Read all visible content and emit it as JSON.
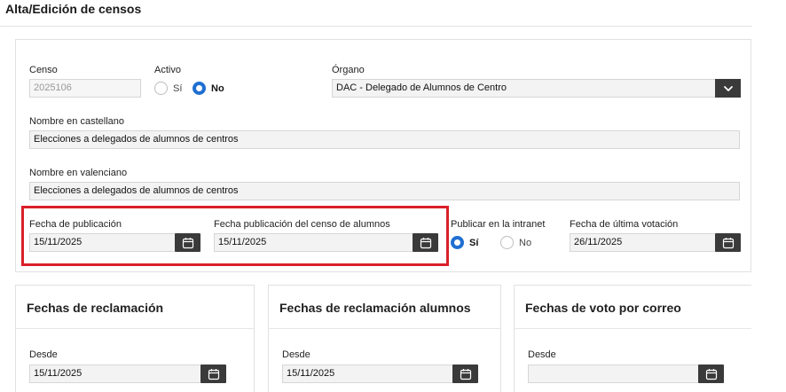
{
  "page": {
    "title": "Alta/Edición de censos"
  },
  "form": {
    "censo": {
      "label": "Censo",
      "value": "2025106"
    },
    "activo": {
      "label": "Activo",
      "options": [
        "Sí",
        "No"
      ],
      "selected": "No"
    },
    "organo": {
      "label": "Órgano",
      "value": "DAC - Delegado de Alumnos de Centro"
    },
    "nombre_castellano": {
      "label": "Nombre en castellano",
      "value": "Elecciones a delegados de alumnos de centros"
    },
    "nombre_valenciano": {
      "label": "Nombre en valenciano",
      "value": "Elecciones a delegados de alumnos de centros"
    },
    "fecha_publicacion": {
      "label": "Fecha de publicación",
      "value": "15/11/2025"
    },
    "fecha_publicacion_censo": {
      "label": "Fecha publicación del censo de alumnos",
      "value": "15/11/2025"
    },
    "publicar_intranet": {
      "label": "Publicar en la intranet",
      "options": [
        "Sí",
        "No"
      ],
      "selected": "Sí"
    },
    "fecha_ultima_votacion": {
      "label": "Fecha de última votación",
      "value": "26/11/2025"
    }
  },
  "cards": [
    {
      "title": "Fechas de reclamación",
      "desde_label": "Desde",
      "desde_value": "15/11/2025"
    },
    {
      "title": "Fechas de reclamación alumnos",
      "desde_label": "Desde",
      "desde_value": "15/11/2025"
    },
    {
      "title": "Fechas de voto por correo",
      "desde_label": "Desde",
      "desde_value": ""
    }
  ],
  "colors": {
    "accent": "#1f6fd1",
    "highlight": "#d9202a",
    "button_dark": "#3a3a3a"
  }
}
